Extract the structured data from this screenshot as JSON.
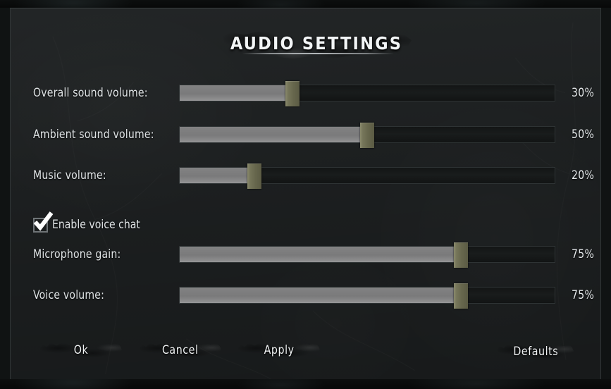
{
  "window": {
    "title": "AUDIO SETTINGS"
  },
  "theme": {
    "panel_bg": "#1e2122",
    "slider_track": "#161919",
    "slider_fill": "#7d7d7e",
    "slider_handle": "#67674d",
    "text": "#dfe3e5",
    "button_face": "#6c7072"
  },
  "settings": {
    "sliders": [
      {
        "label": "Overall sound volume:",
        "value": 30,
        "display": "30%"
      },
      {
        "label": "Ambient sound volume:",
        "value": 50,
        "display": "50%"
      },
      {
        "label": "Music volume:",
        "value": 20,
        "display": "20%"
      },
      {
        "label": "Microphone gain:",
        "value": 75,
        "display": "75%"
      },
      {
        "label": "Voice volume:",
        "value": 75,
        "display": "75%"
      }
    ],
    "checkbox": {
      "label": "Enable voice chat",
      "checked": true,
      "icon": "checkmark-icon"
    }
  },
  "buttons": {
    "ok": "Ok",
    "cancel": "Cancel",
    "apply": "Apply",
    "defaults": "Defaults"
  }
}
